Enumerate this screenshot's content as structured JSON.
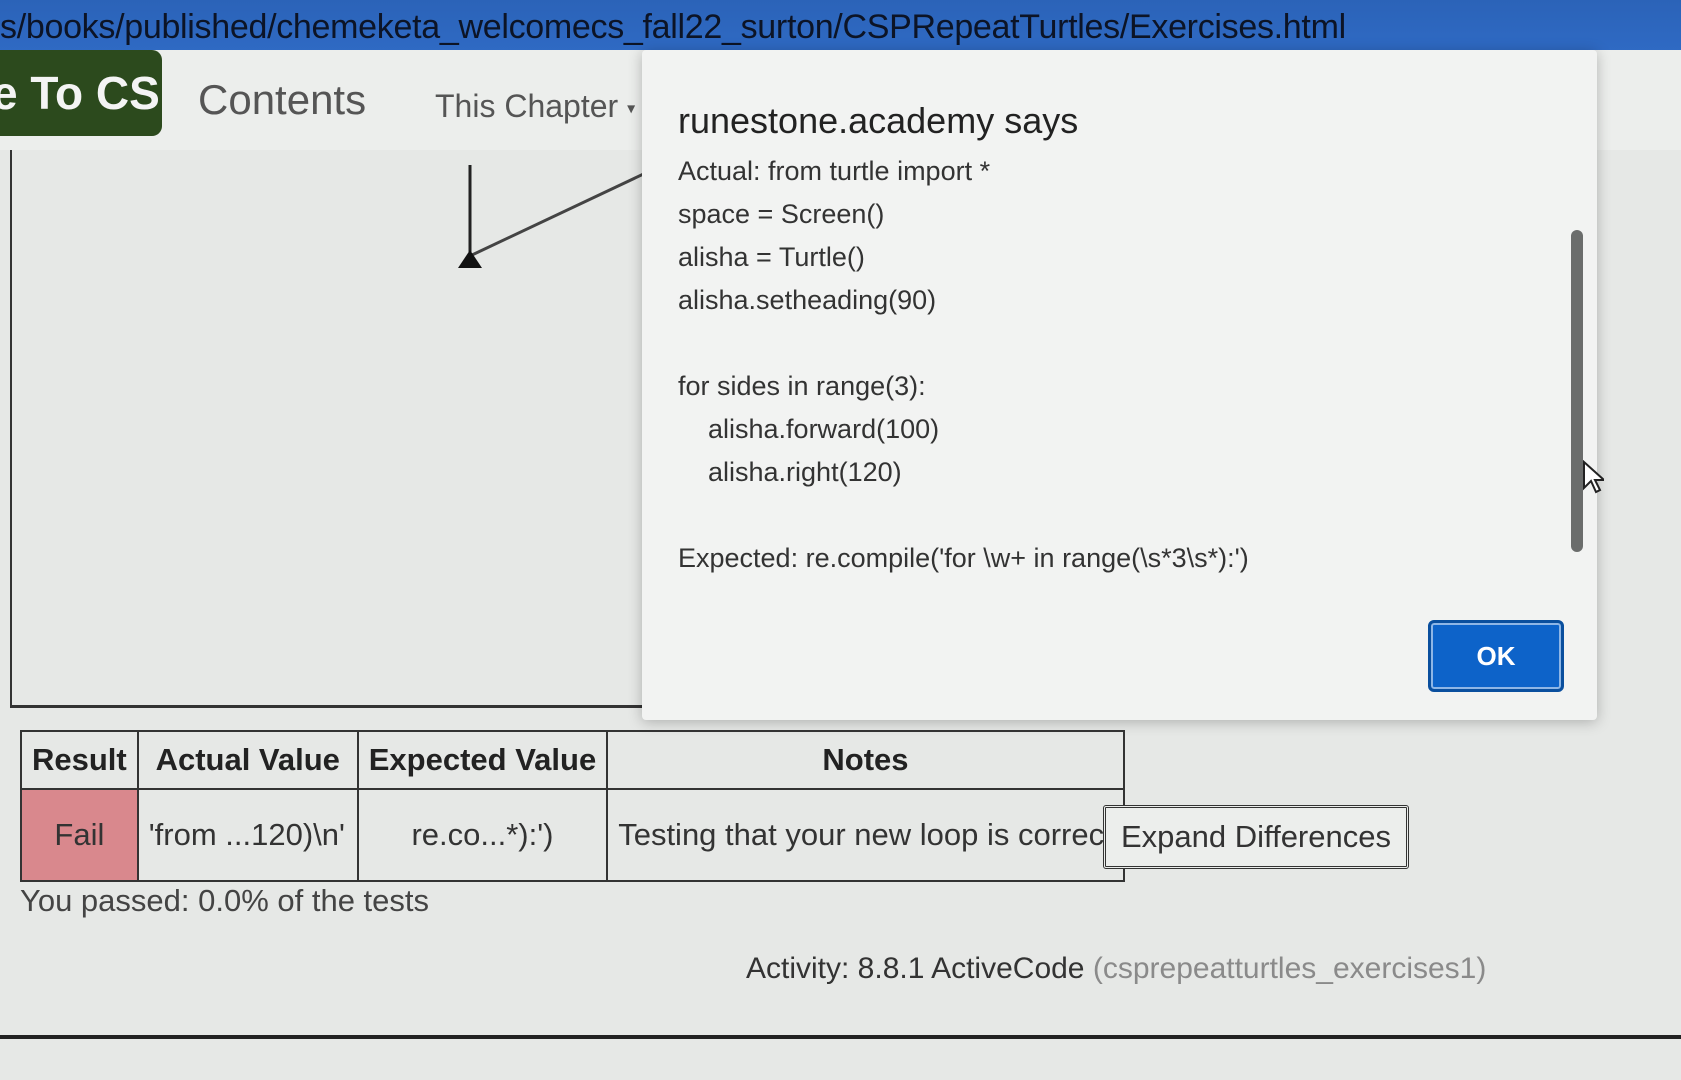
{
  "browser": {
    "url_fragment": "s/books/published/chemeketa_welcomecs_fall22_surton/CSPRepeatTurtles/Exercises.html"
  },
  "navbar": {
    "brand": "e To CS",
    "contents_label": "Contents",
    "chapter_label": "This Chapter"
  },
  "dialog": {
    "title": "runestone.academy says",
    "message": "Actual: from turtle import *\nspace = Screen()\nalisha = Turtle()\nalisha.setheading(90)\n\nfor sides in range(3):\n    alisha.forward(100)\n    alisha.right(120)\n\nExpected: re.compile('for \\w+ in range(\\s*3\\s*):')",
    "ok_label": "OK"
  },
  "results_table": {
    "headers": [
      "Result",
      "Actual Value",
      "Expected Value",
      "Notes"
    ],
    "rows": [
      {
        "result": "Fail",
        "actual": "'from ...120)\\n'",
        "expected": "re.co...*):')",
        "notes": "Testing that your new loop is correct"
      }
    ]
  },
  "expand_label": "Expand Differences",
  "passed_text": "You passed: 0.0% of the tests",
  "activity": {
    "label": "Activity: 8.8.1 ActiveCode",
    "code": "(csprepeatturtles_exercises1)"
  },
  "colors": {
    "fail_bg": "#d9888d",
    "ok_button": "#0d63c9",
    "brand_bg": "#2c4a1d",
    "url_bar": "#2f6ac4"
  }
}
